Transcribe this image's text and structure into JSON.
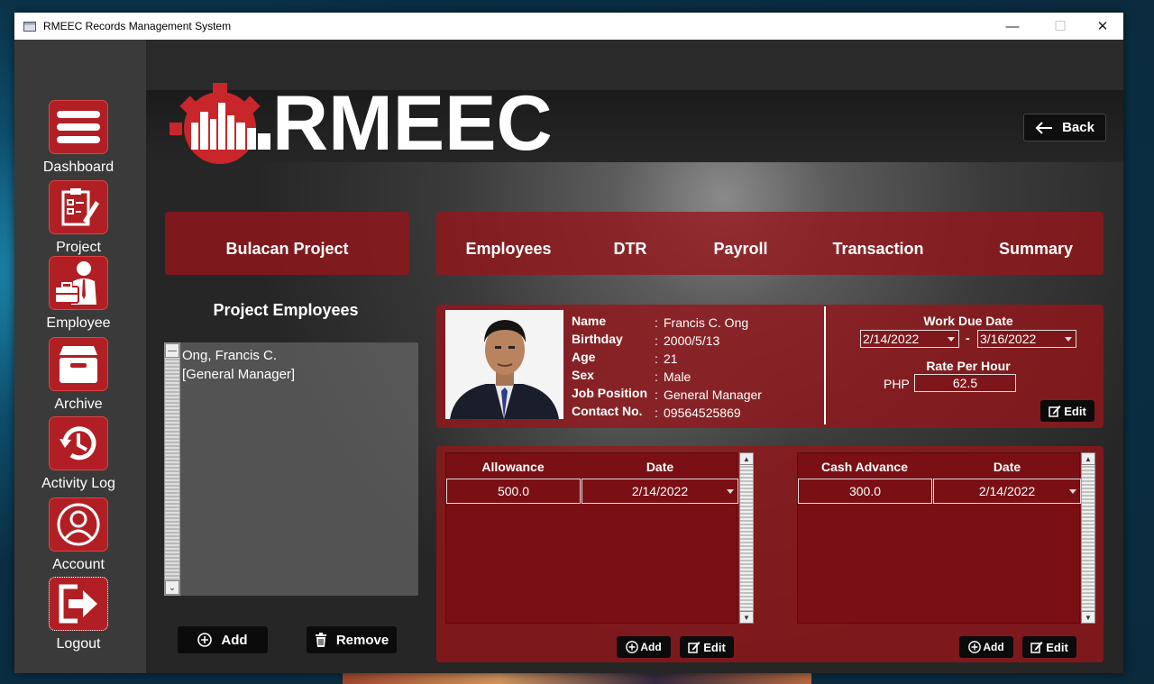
{
  "window": {
    "title": "RMEEC Records Management System",
    "controls": {
      "minimize": "—",
      "maximize": "☐",
      "close": "✕"
    }
  },
  "sidebar": {
    "items": [
      {
        "label": "Dashboard",
        "icon": "hamburger-menu-icon"
      },
      {
        "label": "Project",
        "icon": "clipboard-edit-icon"
      },
      {
        "label": "Employee",
        "icon": "employee-briefcase-icon"
      },
      {
        "label": "Archive",
        "icon": "archive-box-icon"
      },
      {
        "label": "Activity Log",
        "icon": "history-clock-icon"
      },
      {
        "label": "Account",
        "icon": "user-circle-icon"
      },
      {
        "label": "Logout",
        "icon": "logout-exit-icon"
      }
    ]
  },
  "brand": {
    "colors": {
      "accent": "#b11f24",
      "panel": "#96161a",
      "dark": "#0b0b0b"
    }
  },
  "header": {
    "back_label": "Back",
    "back_icon": "arrow-left-icon"
  },
  "project": {
    "name": "Bulacan Project"
  },
  "tabs": [
    {
      "label": "Employees"
    },
    {
      "label": "DTR"
    },
    {
      "label": "Payroll"
    },
    {
      "label": "Transaction"
    },
    {
      "label": "Summary"
    }
  ],
  "employees_panel": {
    "title": "Project Employees",
    "list": [
      {
        "name": "Ong, Francis C.",
        "role": "[General Manager]"
      }
    ],
    "add_label": "Add",
    "remove_label": "Remove"
  },
  "profile": {
    "labels": {
      "name": "Name",
      "birthday": "Birthday",
      "age": "Age",
      "sex": "Sex",
      "job": "Job Position",
      "contact": "Contact No."
    },
    "values": {
      "name": "Francis C. Ong",
      "birthday": "2000/5/13",
      "age": "21",
      "sex": "Male",
      "job": "General Manager",
      "contact": "09564525869"
    },
    "separator": ":"
  },
  "work": {
    "due_title": "Work Due Date",
    "start": "2/14/2022",
    "dash": "-",
    "end": "3/16/2022",
    "rate_title": "Rate Per Hour",
    "currency": "PHP",
    "rate": "62.5",
    "edit_label": "Edit"
  },
  "allowance": {
    "col1": "Allowance",
    "col2": "Date",
    "rows": [
      {
        "amount": "500.0",
        "date": "2/14/2022"
      }
    ],
    "add_label": "Add",
    "edit_label": "Edit"
  },
  "cash_advance": {
    "col1": "Cash Advance",
    "col2": "Date",
    "rows": [
      {
        "amount": "300.0",
        "date": "2/14/2022"
      }
    ],
    "add_label": "Add",
    "edit_label": "Edit"
  }
}
